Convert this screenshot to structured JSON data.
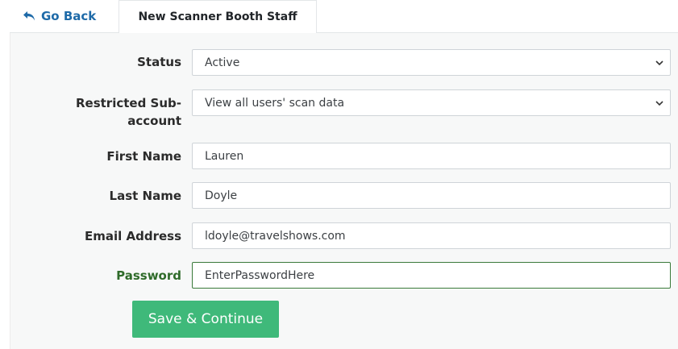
{
  "nav": {
    "back_label": "Go Back",
    "active_tab_label": "New Scanner Booth Staff"
  },
  "form": {
    "status": {
      "label": "Status",
      "value": "Active"
    },
    "restricted": {
      "label_line1": "Restricted Sub-",
      "label_line2": "account",
      "value": "View all users' scan data"
    },
    "first_name": {
      "label": "First Name",
      "value": "Lauren"
    },
    "last_name": {
      "label": "Last Name",
      "value": "Doyle"
    },
    "email": {
      "label": "Email Address",
      "value": "ldoyle@travelshows.com"
    },
    "password": {
      "label": "Password",
      "value": "EnterPasswordHere"
    },
    "save_label": "Save & Continue"
  },
  "icons": {
    "back": "reply-arrow-icon",
    "select": "chevron-down-icon"
  },
  "colors": {
    "link": "#1e6aa8",
    "accent_button": "#3fb97a",
    "password_highlight": "#2f6b2a"
  }
}
